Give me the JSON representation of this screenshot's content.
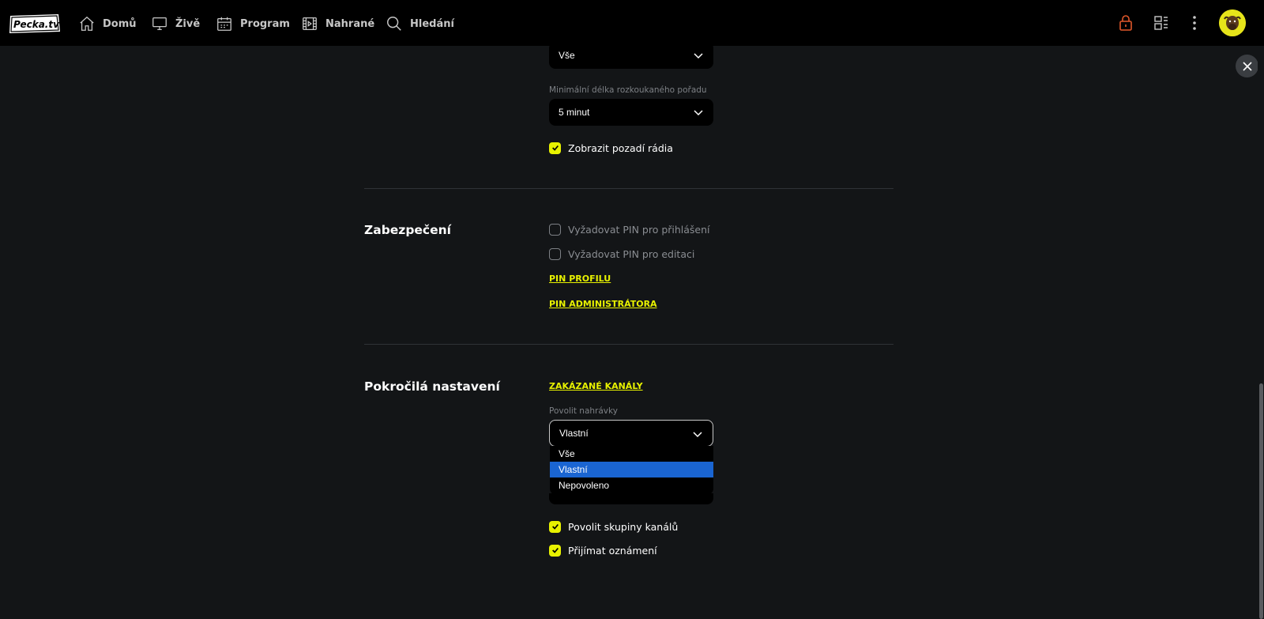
{
  "nav": {
    "items": [
      {
        "label": "Domů",
        "icon": "home-icon"
      },
      {
        "label": "Živě",
        "icon": "monitor-icon"
      },
      {
        "label": "Program",
        "icon": "calendar-icon"
      },
      {
        "label": "Nahrané",
        "icon": "film-icon"
      },
      {
        "label": "Hledání",
        "icon": "search-icon"
      }
    ],
    "logo_text": "Pecka TV"
  },
  "colors": {
    "accent": "#e8f200",
    "lock": "#e2582a",
    "selected": "#1a65d2",
    "background": "#131517"
  },
  "playback": {
    "top_select_value": "Vše",
    "min_length_label": "Minimální délka rozkoukaného pořadu",
    "min_length_value": "5 minut",
    "radio_bg_label": "Zobrazit pozadí rádia",
    "radio_bg_checked": true
  },
  "security": {
    "title": "Zabezpečení",
    "pin_login_label": "Vyžadovat PIN pro přihlášení",
    "pin_edit_label": "Vyžadovat PIN pro editaci",
    "pin_profile_link": "PIN PROFILU",
    "pin_admin_link": "PIN ADMINISTRÁTORA"
  },
  "advanced": {
    "title": "Pokročilá nastavení",
    "blocked_channels_link": "ZAKÁZANÉ KANÁLY",
    "recordings_label": "Povolit nahrávky",
    "recordings_value": "Vlastní",
    "recordings_options": [
      "Vše",
      "Vlastní",
      "Nepovoleno"
    ],
    "channel_groups_label": "Povolit skupiny kanálů",
    "notifications_label": "Přijímat oznámení"
  }
}
